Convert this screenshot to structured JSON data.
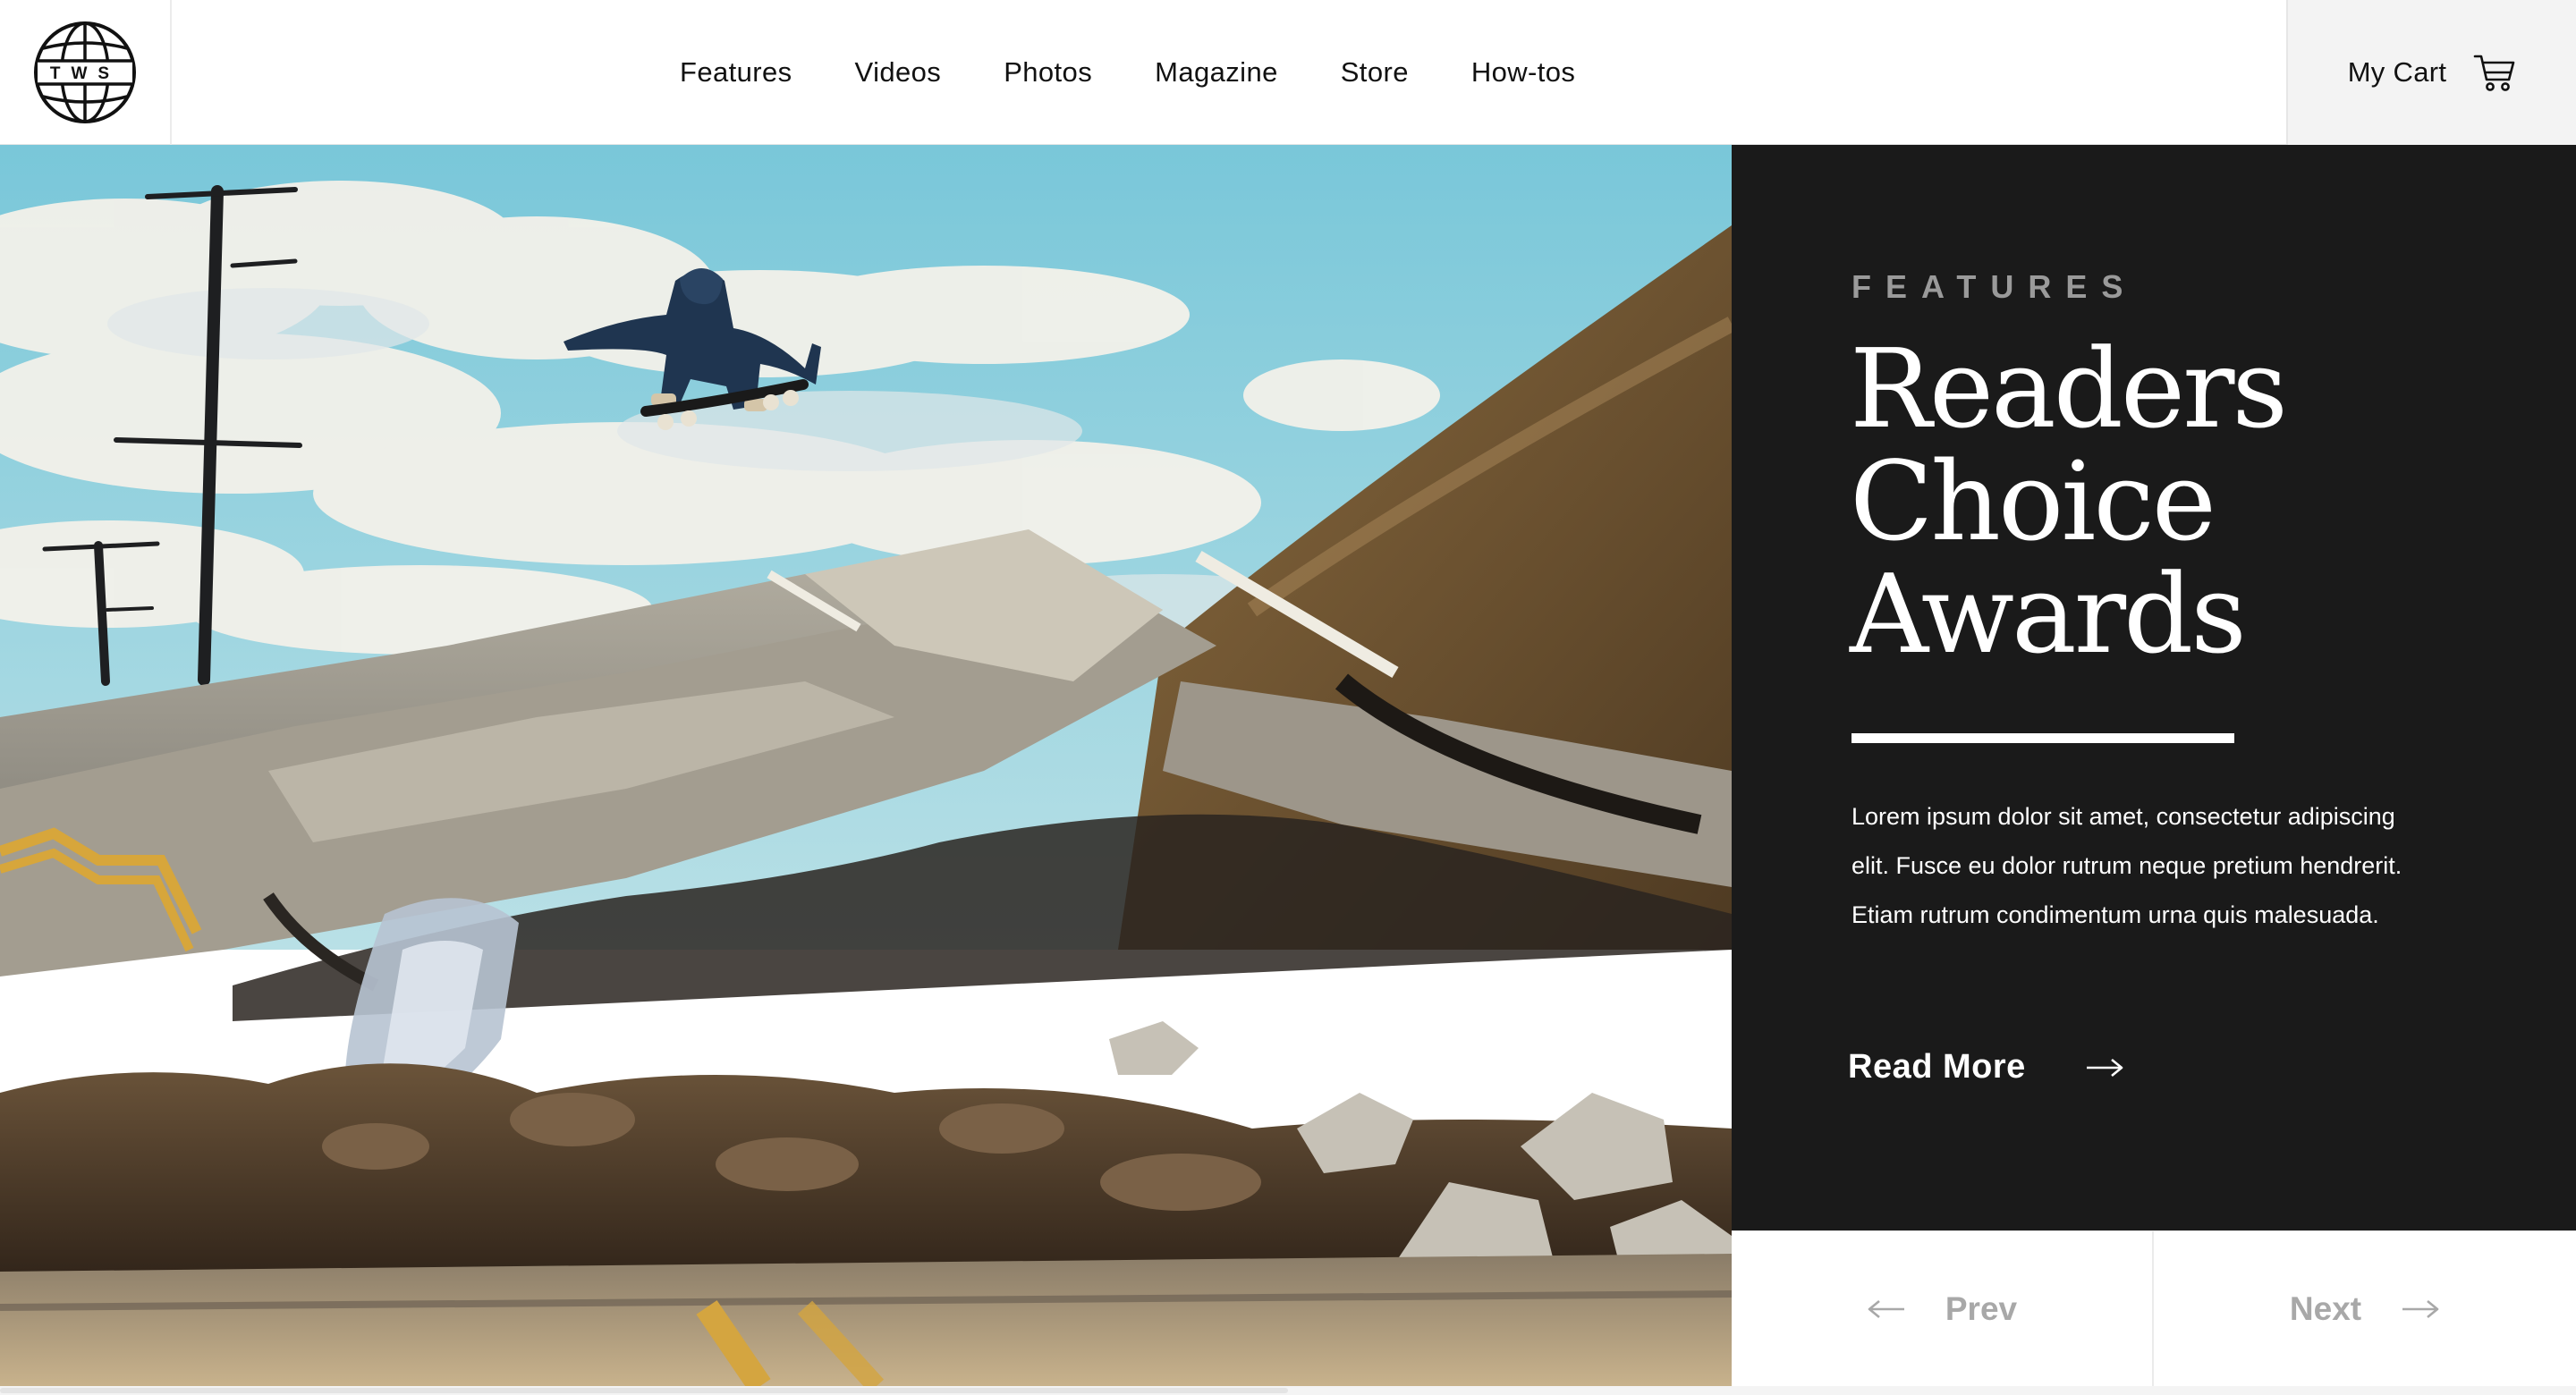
{
  "brand": {
    "logo_text": "TWS"
  },
  "nav": {
    "items": [
      "Features",
      "Videos",
      "Photos",
      "Magazine",
      "Store",
      "How-tos"
    ]
  },
  "cart": {
    "label": "My Cart",
    "icon": "shopping-cart-icon"
  },
  "hero": {
    "image": "skateboarder kickflip over collapsed broken road"
  },
  "feature": {
    "kicker": "FEATURES",
    "title_lines": [
      "Readers",
      "Choice",
      "Awards"
    ],
    "body": "Lorem ipsum dolor sit amet, consectetur adipiscing elit. Fusce eu dolor rutrum neque pretium hendrerit. Etiam rutrum condimentum urna quis malesuada.",
    "cta_label": "Read More"
  },
  "pager": {
    "prev_label": "Prev",
    "next_label": "Next"
  },
  "colors": {
    "panel_bg": "#1a1a1a",
    "kicker": "#9a9a9a",
    "pager_text": "#a8a8a8",
    "cart_bg": "#f3f3f3"
  }
}
